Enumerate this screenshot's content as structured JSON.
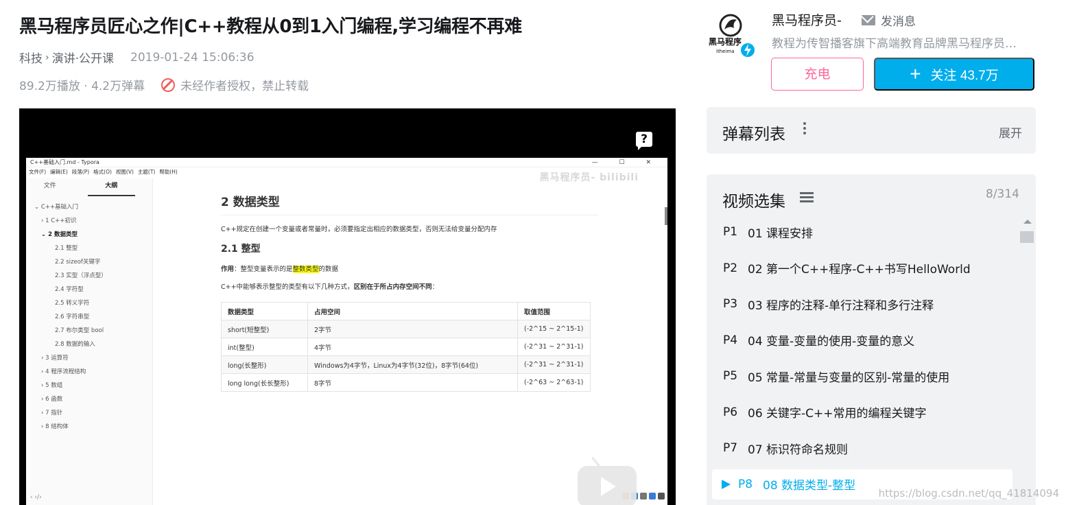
{
  "video": {
    "title": "黑马程序员匠心之作|C++教程从0到1入门编程,学习编程不再难",
    "category": "科技",
    "subcategory": "演讲·公开课",
    "pubdate": "2019-01-24 15:06:36",
    "stats": "89.2万播放 · 4.2万弹幕",
    "copyright_notice": "未经作者授权，禁止转载"
  },
  "uploader": {
    "name": "黑马程序员-",
    "message_label": "发消息",
    "description": "教程为传智播客旗下高端教育品牌黑马程序员…",
    "avatar_text": "黑马程序",
    "avatar_sub": "itheima",
    "charge_label": "充电",
    "follow_label": "关注 43.7万"
  },
  "player_content": {
    "window_title": "C++基础入门.md - Typora",
    "window_buttons": "— ☐ ✕",
    "menu": [
      "文件(F)",
      "编辑(E)",
      "段落(P)",
      "格式(O)",
      "视图(V)",
      "主题(T)",
      "帮助(H)"
    ],
    "watermark": "黑马程序员- bilibili",
    "sidebar_tabs": [
      "文件",
      "大纲"
    ],
    "outline": [
      {
        "text": "⌄ C++基础入门",
        "level": 0
      },
      {
        "text": "› 1 C++初识",
        "level": 1
      },
      {
        "text": "⌄ 2 数据类型",
        "level": 1
      },
      {
        "text": "2.1 整型",
        "level": 2
      },
      {
        "text": "2.2 sizeof关键字",
        "level": 2
      },
      {
        "text": "2.3 实型（浮点型）",
        "level": 2
      },
      {
        "text": "2.4 字符型",
        "level": 2
      },
      {
        "text": "2.5 转义字符",
        "level": 2
      },
      {
        "text": "2.6 字符串型",
        "level": 2
      },
      {
        "text": "2.7 布尔类型 bool",
        "level": 2
      },
      {
        "text": "2.8 数据的输入",
        "level": 2
      },
      {
        "text": "› 3 运算符",
        "level": 1
      },
      {
        "text": "› 4 程序流程结构",
        "level": 1
      },
      {
        "text": "› 5 数组",
        "level": 1
      },
      {
        "text": "› 6 函数",
        "level": 1
      },
      {
        "text": "› 7 指针",
        "level": 1
      },
      {
        "text": "› 8 结构体",
        "level": 1
      }
    ],
    "sidebar_footer": "‹ ‹/›",
    "doc": {
      "h2": "2 数据类型",
      "intro": "C++规定在创建一个变量或者常量时，必须要指定出相应的数据类型，否则无法给变量分配内存",
      "h3": "2.1 整型",
      "purpose_label": "作用",
      "purpose_pre": "：整型变量表示的是",
      "purpose_highlight": "整数类型",
      "purpose_post": "的数据",
      "ways_pre": "C++中能够表示整型的类型有以下几种方式，",
      "ways_bold": "区别在于所占内存空间不同",
      "ways_post": "：",
      "table_headers": [
        "数据类型",
        "占用空间",
        "取值范围"
      ],
      "table_rows": [
        [
          "short(短整型)",
          "2字节",
          "(-2^15 ~ 2^15-1)"
        ],
        [
          "int(整型)",
          "4字节",
          "(-2^31 ~ 2^31-1)"
        ],
        [
          "long(长整形)",
          "Windows为4字节，Linux为4字节(32位)，8字节(64位)",
          "(-2^31 ~ 2^31-1)"
        ],
        [
          "long long(长长整形)",
          "8字节",
          "(-2^63 ~ 2^63-1)"
        ]
      ]
    },
    "help_glyph": "?"
  },
  "danmaku": {
    "title": "弹幕列表",
    "expand_label": "展开"
  },
  "episodes": {
    "title": "视频选集",
    "count": "8/314",
    "items": [
      {
        "p": "P1",
        "title": "01 课程安排"
      },
      {
        "p": "P2",
        "title": "02 第一个C++程序-C++书写HelloWorld"
      },
      {
        "p": "P3",
        "title": "03 程序的注释-单行注释和多行注释"
      },
      {
        "p": "P4",
        "title": "04 变量-变量的使用-变量的意义"
      },
      {
        "p": "P5",
        "title": "05 常量-常量与变量的区别-常量的使用"
      },
      {
        "p": "P6",
        "title": "06 关键字-C++常用的编程关键字"
      },
      {
        "p": "P7",
        "title": "07 标识符命名规则"
      },
      {
        "p": "P8",
        "title": "08 数据类型-整型"
      }
    ]
  },
  "watermark": "https://blog.csdn.net/qq_41814094",
  "colors": {
    "accent": "#00aeec",
    "charge": "#ff6699",
    "muted": "#9499a0",
    "panel_bg": "#f1f2f3"
  }
}
